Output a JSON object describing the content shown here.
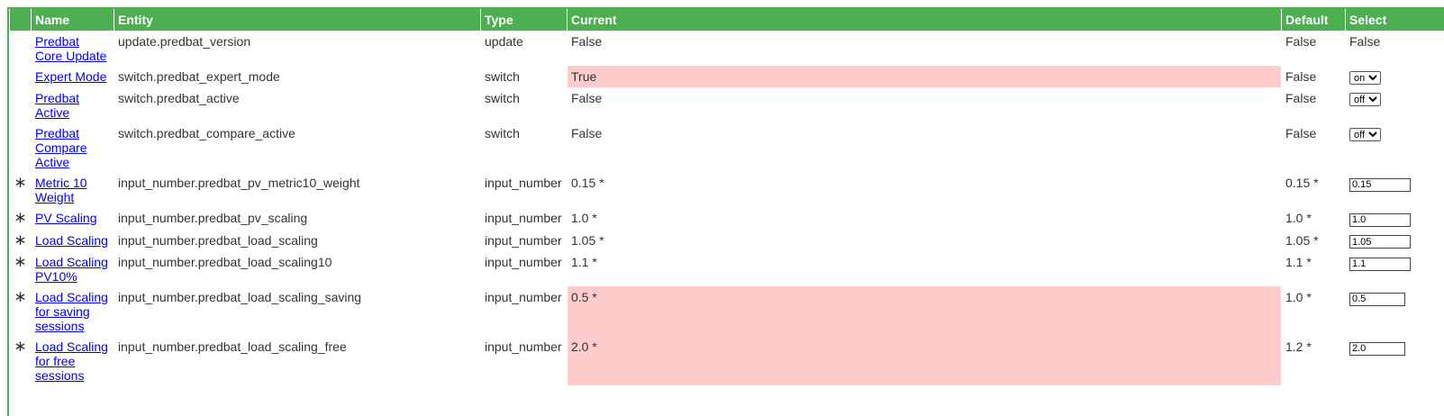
{
  "headers": {
    "name": "Name",
    "entity": "Entity",
    "type": "Type",
    "current": "Current",
    "default": "Default",
    "select": "Select"
  },
  "rows": [
    {
      "star": "",
      "name": "Predbat Core Update",
      "entity": "update.predbat_version",
      "type": "update",
      "current": "False",
      "default": "False",
      "select_text": "False"
    },
    {
      "star": "",
      "name": "Expert Mode",
      "entity": "switch.predbat_expert_mode",
      "type": "switch",
      "current": "True",
      "default": "False",
      "select_value": "on"
    },
    {
      "star": "",
      "name": "Predbat Active",
      "entity": "switch.predbat_active",
      "type": "switch",
      "current": "False",
      "default": "False",
      "select_value": "off"
    },
    {
      "star": "",
      "name": "Predbat Compare Active",
      "entity": "switch.predbat_compare_active",
      "type": "switch",
      "current": "False",
      "default": "False",
      "select_value": "off"
    },
    {
      "star": "∗",
      "name": "Metric 10 Weight",
      "entity": "input_number.predbat_pv_metric10_weight",
      "type": "input_number",
      "current": "0.15 *",
      "default": "0.15 *",
      "input_value": "0.15"
    },
    {
      "star": "∗",
      "name": "PV Scaling",
      "entity": "input_number.predbat_pv_scaling",
      "type": "input_number",
      "current": "1.0 *",
      "default": "1.0 *",
      "input_value": "1.0"
    },
    {
      "star": "∗",
      "name": "Load Scaling",
      "entity": "input_number.predbat_load_scaling",
      "type": "input_number",
      "current": "1.05 *",
      "default": "1.05 *",
      "input_value": "1.05"
    },
    {
      "star": "∗",
      "name": "Load Scaling PV10%",
      "entity": "input_number.predbat_load_scaling10",
      "type": "input_number",
      "current": "1.1 *",
      "default": "1.1 *",
      "input_value": "1.1"
    },
    {
      "star": "∗",
      "name": "Load Scaling for saving sessions",
      "entity": "input_number.predbat_load_scaling_saving",
      "type": "input_number",
      "current": "0.5 *",
      "default": "1.0 *",
      "input_value": "0.5"
    },
    {
      "star": "∗",
      "name": "Load Scaling for free sessions",
      "entity": "input_number.predbat_load_scaling_free",
      "type": "input_number",
      "current": "2.0 *",
      "default": "1.2 *",
      "input_value": "2.0"
    }
  ],
  "select_options": [
    "on",
    "off"
  ],
  "colors": {
    "header_bg": "#4caf50",
    "changed_bg": "#ffcccc",
    "link": "#0000ee"
  }
}
